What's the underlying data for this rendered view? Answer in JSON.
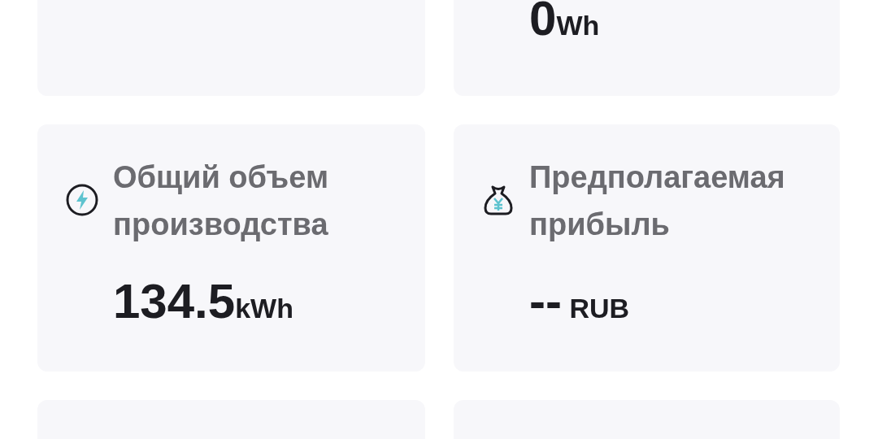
{
  "cards": [
    {
      "kind": "partial"
    },
    {
      "kind": "value_only",
      "value": "0",
      "unit": "Wh"
    },
    {
      "kind": "energy",
      "title": "Общий объем производства",
      "value": "134.5",
      "unit": "kWh"
    },
    {
      "kind": "profit",
      "title": "Предполагаемая прибыль",
      "value": "--",
      "unit": " RUB"
    },
    {
      "kind": "partial"
    },
    {
      "kind": "partial"
    }
  ]
}
